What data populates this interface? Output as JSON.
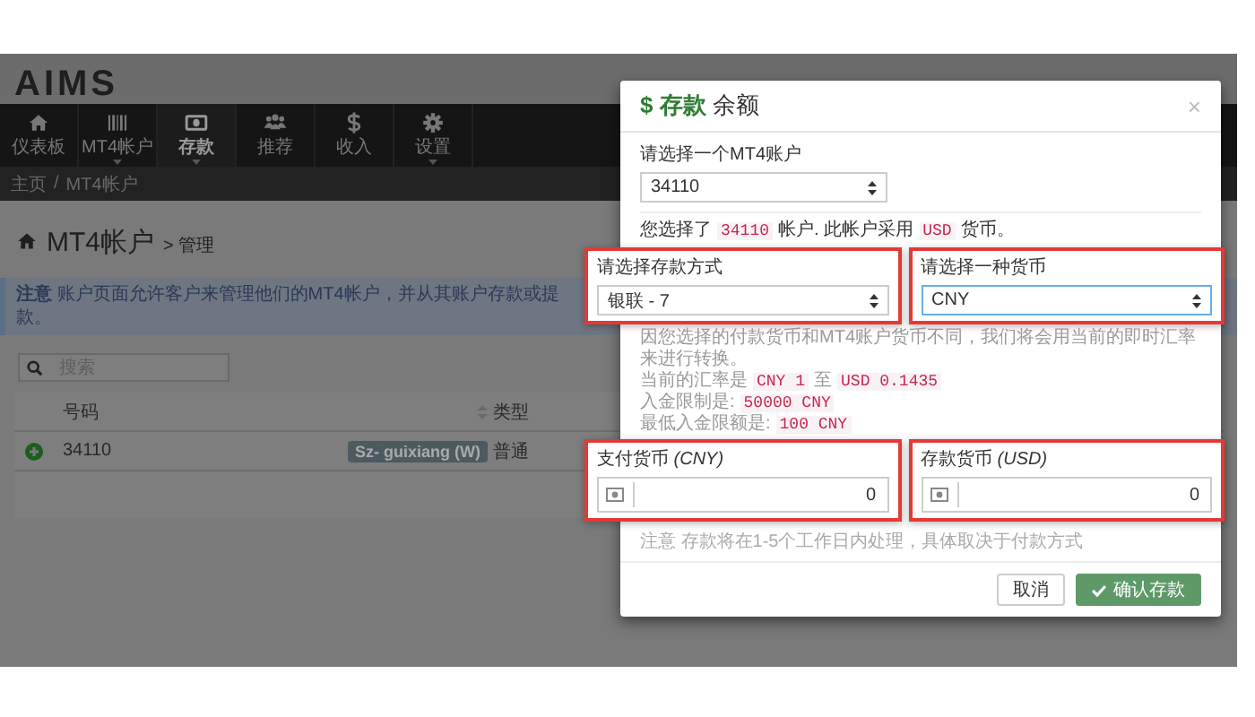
{
  "logo": "AIMS",
  "nav": [
    {
      "label": "仪表板",
      "selected": false,
      "dropdown": false
    },
    {
      "label": "MT4帐户",
      "selected": false,
      "dropdown": true
    },
    {
      "label": "存款",
      "selected": true,
      "dropdown": true
    },
    {
      "label": "推荐",
      "selected": false,
      "dropdown": false
    },
    {
      "label": "收入",
      "selected": false,
      "dropdown": false
    },
    {
      "label": "设置",
      "selected": false,
      "dropdown": true
    }
  ],
  "breadcrumb": {
    "items": [
      "主页",
      "MT4帐户"
    ],
    "separator": "/"
  },
  "page_title": "MT4帐户",
  "page_subtitle": "> 管理",
  "notice": "**注意** 账户页面允许客户来管理他们的MT4帐户，并从其账户存款或提款。",
  "search": {
    "placeholder": "搜索"
  },
  "table": {
    "columns": [
      "号码",
      "类型"
    ],
    "rows": [
      {
        "number": "34110",
        "tag": "Sz- guixiang (W)",
        "type": "普通"
      }
    ]
  },
  "modal": {
    "title_symbol": "$",
    "title": "存款",
    "title_suffix": "余额",
    "close": "×",
    "account": {
      "label": "请选择一个MT4账户",
      "value": "34110"
    },
    "info": [
      {
        "text": "您选择了",
        "code": false
      },
      {
        "text": "34110",
        "code": true
      },
      {
        "text": "帐户. 此帐户采用",
        "code": false
      },
      {
        "text": "USD",
        "code": true
      },
      {
        "text": "货币。",
        "code": false
      }
    ],
    "selects": [
      {
        "label": "请选择存款方式",
        "value": "银联 - 7",
        "focused": false,
        "highlighted": true
      },
      {
        "label": "请选择一种货币",
        "value": "CNY",
        "focused": true,
        "highlighted": true
      }
    ],
    "conversion": [
      [
        {
          "text": "因您选择的付款货币和MT4账户货币不同，我们将会用当前的即时汇率来进行转换。",
          "code": false
        }
      ],
      [
        {
          "text": "当前的汇率是",
          "code": false
        },
        {
          "text": "CNY 1",
          "code": true
        },
        {
          "text": "至",
          "code": false
        },
        {
          "text": "USD 0.1435",
          "code": true
        }
      ],
      [
        {
          "text": "入金限制是:",
          "code": false
        },
        {
          "text": "50000 CNY",
          "code": true
        }
      ],
      [
        {
          "text": "最低入金限额是:",
          "code": false
        },
        {
          "text": "100 CNY",
          "code": true
        }
      ]
    ],
    "amounts": [
      {
        "label": "支付货币 *(CNY)*",
        "value": "0",
        "highlighted": true
      },
      {
        "label": "存款货币 *(USD)*",
        "value": "0",
        "highlighted": true
      }
    ],
    "note": "注意 存款将在1-5个工作日内处理，具体取决于付款方式",
    "buttons": [
      {
        "kind": "cancel",
        "label": "取消",
        "disabled": false
      },
      {
        "kind": "confirm",
        "label": "确认存款",
        "disabled": true
      }
    ]
  }
}
